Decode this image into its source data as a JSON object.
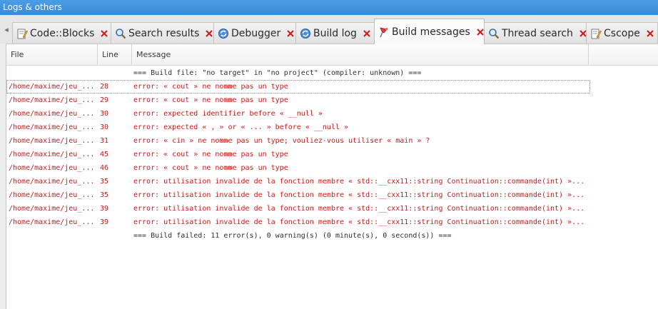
{
  "window": {
    "title": "Logs & others"
  },
  "tabs": [
    {
      "label": "Code::Blocks",
      "icon": "document-pencil-icon",
      "active": false
    },
    {
      "label": "Search results",
      "icon": "magnifier-icon",
      "active": false
    },
    {
      "label": "Debugger",
      "icon": "gear-cycle-icon",
      "active": false
    },
    {
      "label": "Build log",
      "icon": "gear-cycle-icon",
      "active": false
    },
    {
      "label": "Build messages",
      "icon": "pin-flag-icon",
      "active": true
    },
    {
      "label": "Thread search",
      "icon": "magnifier-icon",
      "active": false
    },
    {
      "label": "Cscope",
      "icon": "document-pencil-icon",
      "active": false
    }
  ],
  "columns": {
    "file": "File",
    "line": "Line",
    "message": "Message"
  },
  "rows": [
    {
      "file": "",
      "line": "",
      "message": "=== Build file: \"no target\" in \"no project\" (compiler: unknown) ===",
      "type": "info"
    },
    {
      "file": "/home/maxime/jeu_...",
      "line": "28",
      "message": "error: « cout » ne nomme pas un type",
      "type": "error"
    },
    {
      "file": "/home/maxime/jeu_...",
      "line": "29",
      "message": "error: « cout » ne nomme pas un type",
      "type": "error"
    },
    {
      "file": "/home/maxime/jeu_...",
      "line": "30",
      "message": "error: expected identifier before « __null »",
      "type": "error"
    },
    {
      "file": "/home/maxime/jeu_...",
      "line": "30",
      "message": "error: expected « , » or « ... » before « __null »",
      "type": "error"
    },
    {
      "file": "/home/maxime/jeu_...",
      "line": "31",
      "message": "error: « cin » ne nomme pas un type; vouliez-vous utiliser « main » ?",
      "type": "error"
    },
    {
      "file": "/home/maxime/jeu_...",
      "line": "45",
      "message": "error: « cout » ne nomme pas un type",
      "type": "error"
    },
    {
      "file": "/home/maxime/jeu_...",
      "line": "46",
      "message": "error: « cout » ne nomme pas un type",
      "type": "error"
    },
    {
      "file": "/home/maxime/jeu_...",
      "line": "35",
      "message": "error: utilisation invalide de la fonction membre « std::__cxx11::string Continuation::commande(int) »...",
      "type": "error"
    },
    {
      "file": "/home/maxime/jeu_...",
      "line": "35",
      "message": "error: utilisation invalide de la fonction membre « std::__cxx11::string Continuation::commande(int) »...",
      "type": "error"
    },
    {
      "file": "/home/maxime/jeu_...",
      "line": "39",
      "message": "error: utilisation invalide de la fonction membre « std::__cxx11::string Continuation::commande(int) »...",
      "type": "error"
    },
    {
      "file": "/home/maxime/jeu_...",
      "line": "39",
      "message": "error: utilisation invalide de la fonction membre « std::__cxx11::string Continuation::commande(int) »...",
      "type": "error"
    },
    {
      "file": "",
      "line": "",
      "message": "=== Build failed: 11 error(s), 0 warning(s) (0 minute(s), 0 second(s)) ===",
      "type": "info"
    }
  ],
  "colors": {
    "error_text": "#c81a1a",
    "info_text": "#2f2f2f",
    "title_bar": "#3b8ad6",
    "close_x": "#d11f1f"
  }
}
